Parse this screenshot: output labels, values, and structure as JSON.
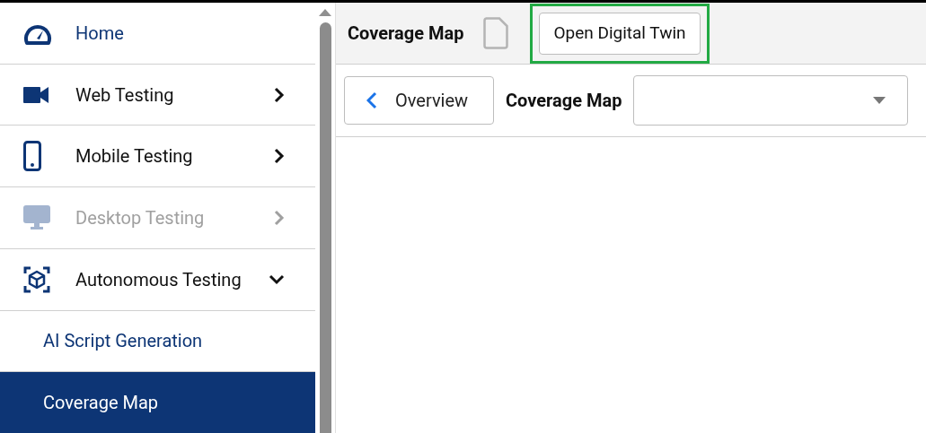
{
  "sidebar": {
    "items": [
      {
        "kind": "nav",
        "label": "Home",
        "disabled": false
      },
      {
        "kind": "group",
        "label": "Web Testing",
        "disabled": false,
        "expanded": false
      },
      {
        "kind": "group",
        "label": "Mobile Testing",
        "disabled": false,
        "expanded": false
      },
      {
        "kind": "group",
        "label": "Desktop Testing",
        "disabled": true,
        "expanded": false
      },
      {
        "kind": "group",
        "label": "Autonomous Testing",
        "disabled": false,
        "expanded": true,
        "children": [
          {
            "label": "AI Script Generation",
            "selected": false
          },
          {
            "label": "Coverage Map",
            "selected": true
          }
        ]
      }
    ]
  },
  "header": {
    "title": "Coverage Map",
    "button": {
      "label": "Open Digital Twin",
      "highlighted": true
    }
  },
  "toolbar": {
    "back_button": "Overview",
    "label": "Coverage Map"
  }
}
